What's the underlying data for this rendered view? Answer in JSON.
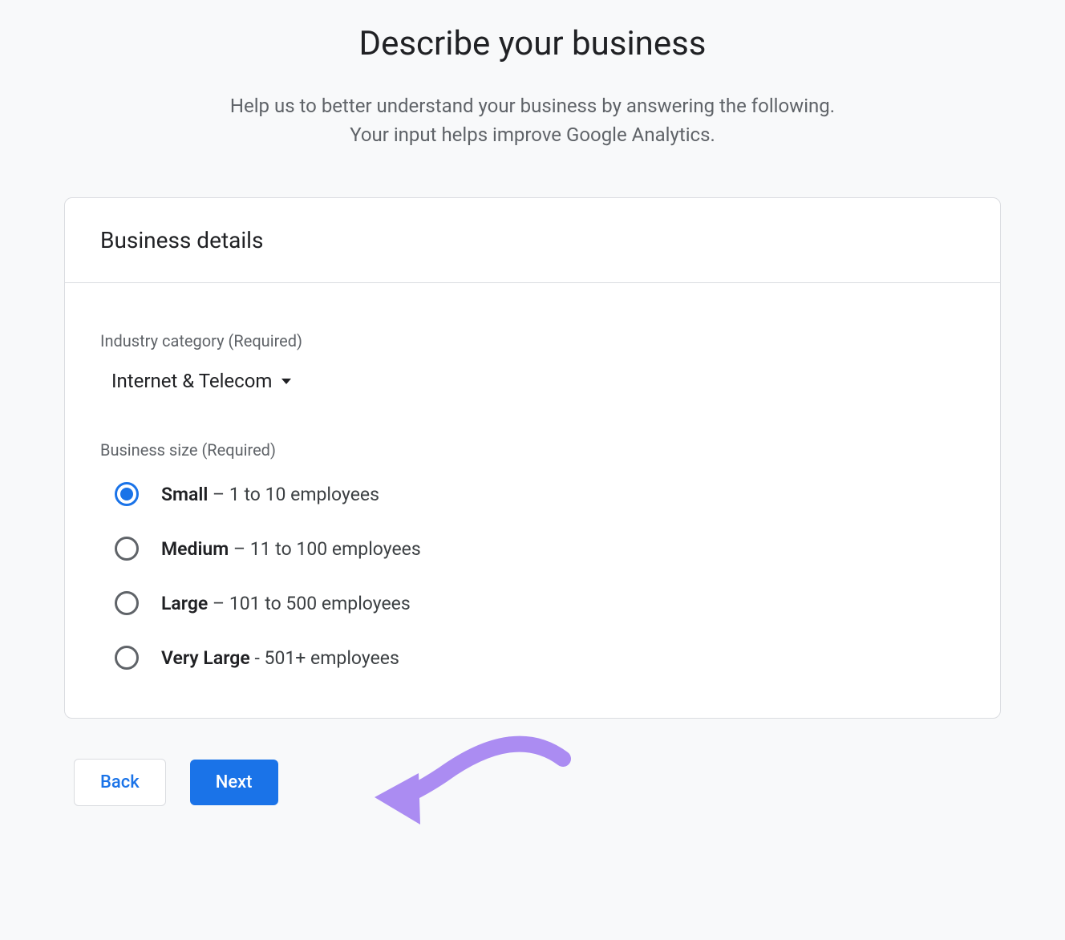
{
  "header": {
    "title": "Describe your business",
    "subtitle_line1": "Help us to better understand your business by answering the following.",
    "subtitle_line2": "Your input helps improve Google Analytics."
  },
  "card": {
    "title": "Business details",
    "industry": {
      "label": "Industry category (Required)",
      "value": "Internet & Telecom"
    },
    "size": {
      "label": "Business size (Required)",
      "options": [
        {
          "name": "Small",
          "suffix": " – 1 to 10 employees",
          "selected": true
        },
        {
          "name": "Medium",
          "suffix": " – 11 to 100 employees",
          "selected": false
        },
        {
          "name": "Large",
          "suffix": " – 101 to 500 employees",
          "selected": false
        },
        {
          "name": "Very Large",
          "suffix": " - 501+ employees",
          "selected": false
        }
      ]
    }
  },
  "buttons": {
    "back": "Back",
    "next": "Next"
  }
}
